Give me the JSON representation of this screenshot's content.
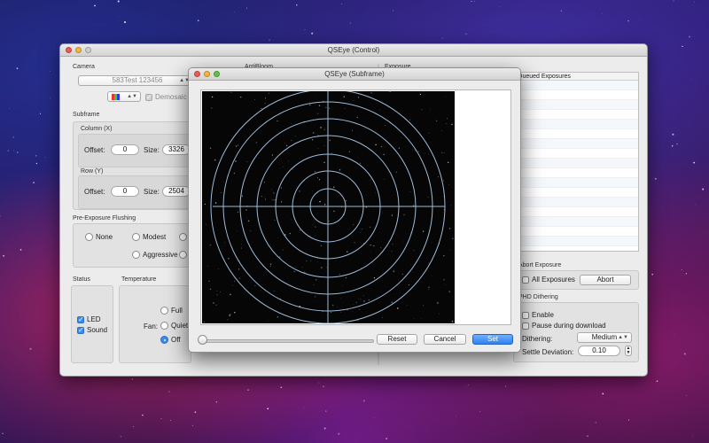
{
  "main_window": {
    "title": "QSEye (Control)",
    "camera": {
      "label": "Camera",
      "selected": "583Test 123456",
      "demosaic_label": "Demosaic",
      "demosaic_checked": true
    },
    "antibloom_label": "AntiBloom",
    "exposure_label": "Exposure",
    "subframe": {
      "label": "Subframe",
      "column": {
        "label": "Column (X)",
        "offset_label": "Offset:",
        "offset": "0",
        "size_label": "Size:",
        "size": "3326"
      },
      "row": {
        "label": "Row (Y)",
        "offset_label": "Offset:",
        "offset": "0",
        "size_label": "Size:",
        "size": "2504"
      }
    },
    "flushing": {
      "label": "Pre-Exposure Flushing",
      "options": [
        "None",
        "Modest",
        "Aggressive"
      ]
    },
    "status": {
      "label": "Status",
      "led_label": "LED",
      "led_checked": true,
      "sound_label": "Sound",
      "sound_checked": true
    },
    "temperature": {
      "label": "Temperature",
      "fan_label": "Fan:",
      "fan_options": [
        "Full",
        "Quiet",
        "Off"
      ],
      "fan_selected": "Off"
    },
    "queued_exposures": {
      "header": "Queued Exposures"
    },
    "abort_exposure": {
      "label": "Abort Exposure",
      "all_label": "All Exposures",
      "abort_button": "Abort"
    },
    "dithering": {
      "label": "PHD Dithering",
      "enable_label": "Enable",
      "pause_label": "Pause during download",
      "dithering_label": "Dithering:",
      "dithering_value": "Medium",
      "settle_label": "Settle Deviation:",
      "settle_value": "0.10"
    }
  },
  "subframe_window": {
    "title": "QSEye (Subframe)",
    "reset_button": "Reset",
    "cancel_button": "Cancel",
    "set_button": "Set",
    "zoom_fraction": 0.0
  },
  "colors": {
    "accent": "#3b8cf0",
    "reticle": "#9fbcd8",
    "window_bg": "#ececec"
  }
}
